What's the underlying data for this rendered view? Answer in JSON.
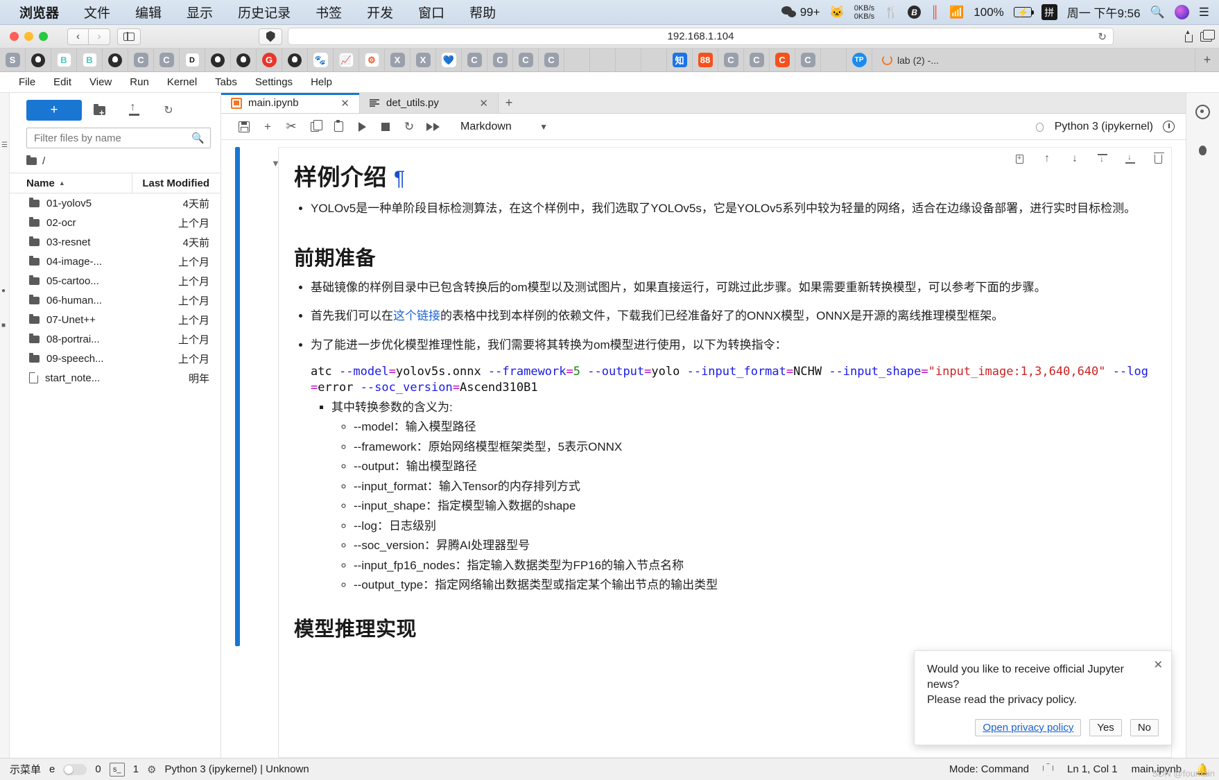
{
  "macbar": {
    "menus": [
      "浏览器",
      "文件",
      "编辑",
      "显示",
      "历史记录",
      "书签",
      "开发",
      "窗口",
      "帮助"
    ],
    "wechat_badge": "99+",
    "net_up": "0KB/s",
    "net_down": "0KB/s",
    "battery_pct": "100%",
    "ime": "拼",
    "clock": "周一 下午9:56"
  },
  "safari": {
    "url": "192.168.1.104",
    "tab_title": "lab (2) -...",
    "favicons": [
      {
        "name": "favicon-s",
        "label": "S",
        "style": "grey"
      },
      {
        "name": "favicon-github",
        "label": "",
        "style": "github"
      },
      {
        "name": "favicon-b1",
        "label": "B",
        "style": "teal"
      },
      {
        "name": "favicon-b2",
        "label": "B",
        "style": "teal"
      },
      {
        "name": "favicon-github-2",
        "label": "",
        "style": "github"
      },
      {
        "name": "favicon-c1",
        "label": "C",
        "style": "grey"
      },
      {
        "name": "favicon-c2",
        "label": "C",
        "style": "grey"
      },
      {
        "name": "favicon-d",
        "label": "D",
        "style": "white"
      },
      {
        "name": "favicon-github-3",
        "label": "",
        "style": "github"
      },
      {
        "name": "favicon-github-4",
        "label": "",
        "style": "github"
      },
      {
        "name": "favicon-g",
        "label": "G",
        "style": "red"
      },
      {
        "name": "favicon-github-5",
        "label": "",
        "style": "github"
      },
      {
        "name": "favicon-baidu",
        "label": "",
        "style": "baidu"
      },
      {
        "name": "favicon-chart",
        "label": "",
        "style": "chart"
      },
      {
        "name": "favicon-flame",
        "label": "",
        "style": "orange"
      },
      {
        "name": "favicon-x1",
        "label": "X",
        "style": "grey"
      },
      {
        "name": "favicon-x2",
        "label": "X",
        "style": "grey"
      },
      {
        "name": "favicon-heart",
        "label": "",
        "style": "heart"
      },
      {
        "name": "favicon-c3",
        "label": "C",
        "style": "grey"
      },
      {
        "name": "favicon-c4",
        "label": "C",
        "style": "grey"
      },
      {
        "name": "favicon-c5",
        "label": "C",
        "style": "grey"
      },
      {
        "name": "favicon-c6",
        "label": "C",
        "style": "grey"
      },
      {
        "name": "favicon-blank-1",
        "label": "",
        "style": "blank"
      },
      {
        "name": "favicon-blank-2",
        "label": "",
        "style": "blank"
      },
      {
        "name": "favicon-blank-3",
        "label": "",
        "style": "blank"
      },
      {
        "name": "favicon-blank-4",
        "label": "",
        "style": "blank"
      },
      {
        "name": "favicon-zhihu",
        "label": "知",
        "style": "bluec"
      },
      {
        "name": "favicon-kuaishou",
        "label": "88",
        "style": "redc"
      },
      {
        "name": "favicon-c7",
        "label": "C",
        "style": "grey"
      },
      {
        "name": "favicon-c8",
        "label": "C",
        "style": "grey"
      },
      {
        "name": "favicon-c9",
        "label": "C",
        "style": "redtext"
      },
      {
        "name": "favicon-c10",
        "label": "C",
        "style": "grey"
      },
      {
        "name": "favicon-blank-5",
        "label": "",
        "style": "blank"
      },
      {
        "name": "favicon-tp",
        "label": "TP",
        "style": "tp"
      }
    ]
  },
  "jupyter": {
    "menu": [
      "File",
      "Edit",
      "View",
      "Run",
      "Kernel",
      "Tabs",
      "Settings",
      "Help"
    ],
    "filebrowser": {
      "new_button": "+",
      "filter_placeholder": "Filter files by name",
      "breadcrumb": "/",
      "columns": [
        "Name",
        "Last Modified"
      ],
      "rows": [
        {
          "name": "01-yolov5",
          "modified": "4天前",
          "type": "folder"
        },
        {
          "name": "02-ocr",
          "modified": "上个月",
          "type": "folder"
        },
        {
          "name": "03-resnet",
          "modified": "4天前",
          "type": "folder"
        },
        {
          "name": "04-image-...",
          "modified": "上个月",
          "type": "folder"
        },
        {
          "name": "05-cartoo...",
          "modified": "上个月",
          "type": "folder"
        },
        {
          "name": "06-human...",
          "modified": "上个月",
          "type": "folder"
        },
        {
          "name": "07-Unet++",
          "modified": "上个月",
          "type": "folder"
        },
        {
          "name": "08-portrai...",
          "modified": "上个月",
          "type": "folder"
        },
        {
          "name": "09-speech...",
          "modified": "上个月",
          "type": "folder"
        },
        {
          "name": "start_note...",
          "modified": "明年",
          "type": "file"
        }
      ]
    },
    "doctabs": [
      {
        "label": "main.ipynb",
        "icon": "notebook-icon",
        "active": true
      },
      {
        "label": "det_utils.py",
        "icon": "python-file-icon",
        "active": false
      }
    ],
    "nbtoolbar": {
      "celltype": "Markdown",
      "kernel": "Python 3 (ipykernel)"
    },
    "notebook": {
      "h1": "样例介绍",
      "pilcrow": "¶",
      "intro_bullet": "YOLOv5是一种单阶段目标检测算法，在这个样例中，我们选取了YOLOv5s，它是YOLOv5系列中较为轻量的网络，适合在边缘设备部署，进行实时目标检测。",
      "h2": "前期准备",
      "prep_b1": "基础镜像的样例目录中已包含转换后的om模型以及测试图片，如果直接运行，可跳过此步骤。如果需要重新转换模型，可以参考下面的步骤。",
      "prep_b2_pre": "首先我们可以在",
      "prep_b2_link": "这个链接",
      "prep_b2_post": "的表格中找到本样例的依赖文件，下载我们已经准备好了的ONNX模型，ONNX是开源的离线推理模型框架。",
      "prep_b3": "为了能进一步优化模型推理性能，我们需要将其转换为om模型进行使用，以下为转换指令：",
      "code": {
        "t1": "atc ",
        "t2": "--model",
        "t3": "=",
        "t4": "yolov5s.onnx ",
        "t5": "--framework",
        "t6": "=",
        "t7": "5",
        "t8": " ",
        "t9": "--output",
        "t10": "=",
        "t11": "yolo ",
        "t12": "--input_format",
        "t13": "=",
        "t14": "NCHW ",
        "t15": "--input_shape",
        "t16": "=",
        "t17": "\"input_image:1,3,640,640\"",
        "t18": " ",
        "t19": "--log",
        "t20": "=",
        "t21": "error ",
        "t22": "--soc_version",
        "t23": "=",
        "t24": "Ascend310B1"
      },
      "params_title": "其中转换参数的含义为:",
      "params": [
        "--model：输入模型路径",
        "--framework：原始网络模型框架类型，5表示ONNX",
        "--output：输出模型路径",
        "--input_format：输入Tensor的内存排列方式",
        "--input_shape：指定模型输入数据的shape",
        "--log：日志级别",
        "--soc_version：昇腾AI处理器型号",
        "--input_fp16_nodes：指定输入数据类型为FP16的输入节点名称",
        "--output_type：指定网络输出数据类型或指定某个输出节点的输出类型"
      ],
      "h2_next": "模型推理实现"
    },
    "toast": {
      "line1": "Would you like to receive official Jupyter news?",
      "line2": "Please read the privacy policy.",
      "privacy": "Open privacy policy",
      "yes": "Yes",
      "no": "No",
      "close": "✕"
    },
    "statusbar": {
      "left_label": "示菜单",
      "e_label": "e",
      "count0": "0",
      "sbox": "s_",
      "count1": "1",
      "kernel_status": "Python 3 (ipykernel) | Unknown",
      "mode": "Mode: Command",
      "position": "Ln 1, Col 1",
      "file": "main.ipynb"
    }
  },
  "watermarks": {
    "left": "SDN @fountain",
    "right": ""
  }
}
